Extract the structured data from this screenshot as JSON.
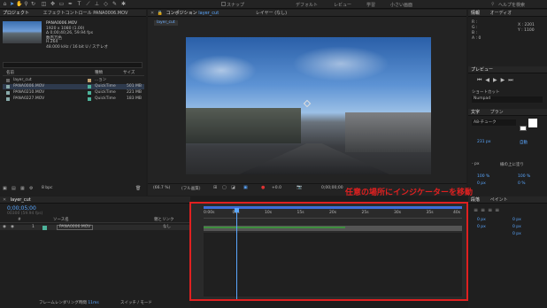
{
  "toolbar": {
    "snap": "スナップ",
    "workspaces": [
      "デフォルト",
      "レビュー",
      "学習",
      "小さい画面"
    ],
    "search_placeholder": "ヘルプを検索"
  },
  "project": {
    "tabs": [
      "プロジェクト",
      "エフェクトコントロール PANA0006.MOV"
    ],
    "file_name": "PANA0006.MOV",
    "meta_lines": [
      "1920 x 1080 (1.00)",
      "Δ 0;00;40;26, 59.94 fps",
      "数百万色",
      "H.264",
      "48.000 kHz / 16 bit U / ステレオ"
    ],
    "headers": [
      "名前",
      "種類",
      "サイズ"
    ],
    "items": [
      {
        "name": "layer_cut",
        "type": "...ョン",
        "size": "",
        "color": "#c0a070"
      },
      {
        "name": "PANA0006.MOV",
        "type": "QuickTime",
        "size": "501 MB",
        "color": "#4db39b"
      },
      {
        "name": "PANA0210.MOV",
        "type": "QuickTime",
        "size": "221 MB",
        "color": "#4db39b"
      },
      {
        "name": "PANA0227.MOV",
        "type": "QuickTime",
        "size": "183 MB",
        "color": "#4db39b"
      }
    ],
    "bit_depth": "8 bpc"
  },
  "composition": {
    "tab_label": "コンポジション",
    "tab_name": "layer_cut",
    "layer_tab": "レイヤー (なし)",
    "sub_tab": "layer_cut",
    "zoom": "(66.7 %)",
    "quality": "(フル画質)",
    "exposure": "+0.0",
    "timecode": "0;00;00;00"
  },
  "info_panel": {
    "tabs": [
      "情報",
      "オーディオ"
    ],
    "values": [
      "R :",
      "G :",
      "B :",
      "A : 0"
    ],
    "coords": [
      "X : 2201",
      "Y : 1100"
    ]
  },
  "preview": {
    "title": "プレビュー",
    "shortcut_label": "ショートカット",
    "shortcut_value": "Numpad"
  },
  "character": {
    "tabs": [
      "文字",
      "プラン"
    ],
    "font": "A8-チューク",
    "size": "231 px",
    "auto": "自動",
    "stroke": "- px",
    "stroke_mode": "線の上に塗り",
    "scale_v": "100 %",
    "scale_h": "100 %",
    "baseline": "0 px",
    "tsume": "0 %"
  },
  "timeline": {
    "tab": "layer_cut",
    "timecode": "0;00;05;00",
    "frame_note": "00300 (59.94 fps)",
    "columns": [
      "ソース名",
      "親とリンク"
    ],
    "layer_index": "1",
    "layer_name": "PANA0006.MOV",
    "parent": "なし",
    "ruler": [
      "0:00s",
      "05s",
      "10s",
      "15s",
      "20s",
      "25s",
      "30s",
      "35s",
      "40s"
    ],
    "playhead_seconds": 5,
    "duration_seconds": 40,
    "footer_render": "フレームレンダリング時間",
    "footer_render_value": "11ms",
    "footer_mode": "スイッチ / モード",
    "annotation": "任意の場所にインジケーターを移動"
  },
  "paragraph": {
    "tabs": [
      "段落",
      "ペイント"
    ],
    "values": [
      "0 px",
      "0 px",
      "0 px",
      "0 px",
      "0 px"
    ]
  },
  "colors": {
    "accent": "#5aa7ff",
    "highlight": "#e02020",
    "track_green": "#3f8f3f"
  }
}
